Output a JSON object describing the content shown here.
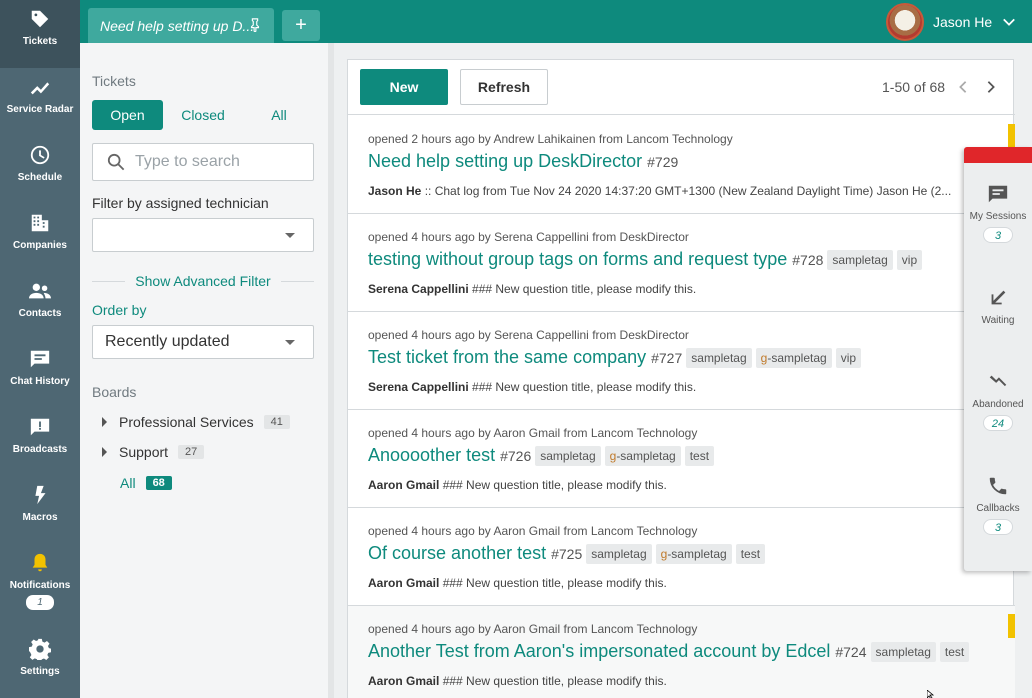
{
  "nav": {
    "items": [
      {
        "label": "Tickets",
        "icon": "tag-icon",
        "active": true
      },
      {
        "label": "Service Radar",
        "icon": "trend-icon"
      },
      {
        "label": "Schedule",
        "icon": "clock-icon"
      },
      {
        "label": "Companies",
        "icon": "building-icon"
      },
      {
        "label": "Contacts",
        "icon": "people-icon"
      },
      {
        "label": "Chat History",
        "icon": "chat-icon"
      },
      {
        "label": "Broadcasts",
        "icon": "alert-icon"
      },
      {
        "label": "Macros",
        "icon": "bolt-icon"
      },
      {
        "label": "Notifications",
        "icon": "bell-icon",
        "badge": "1"
      },
      {
        "label": "Settings",
        "icon": "gear-icon"
      }
    ]
  },
  "topbar": {
    "tab_title": "Need help setting up D...",
    "add_tab": "+",
    "user_name": "Jason He"
  },
  "filter": {
    "heading": "Tickets",
    "status_tabs": [
      "Open",
      "Closed",
      "All"
    ],
    "search_placeholder": "Type to search",
    "technician_label": "Filter by assigned technician",
    "technician_value": "",
    "advanced_filter": "Show Advanced Filter",
    "order_label": "Order by",
    "order_value": "Recently updated",
    "boards_heading": "Boards",
    "boards": [
      {
        "name": "Professional Services",
        "count": "41"
      },
      {
        "name": "Support",
        "count": "27"
      }
    ],
    "all_label": "All",
    "all_count": "68"
  },
  "toolbar": {
    "new_label": "New",
    "refresh_label": "Refresh",
    "pager": "1-50 of 68"
  },
  "tickets": [
    {
      "meta_opened": "opened 2 hours ago by",
      "author": "Andrew Lahikainen",
      "from": "from",
      "company": "Lancom Technology",
      "title": "Need help setting up DeskDirector",
      "number": "#729",
      "tags": [],
      "snippet_author": "Jason He",
      "snippet_text": " :: Chat log from Tue Nov 24 2020 14:37:20 GMT+1300 (New Zealand Daylight Time) Jason He (2...",
      "flag": true
    },
    {
      "meta_opened": "opened 4 hours ago by",
      "author": "Serena Cappellini",
      "from": "from",
      "company": "DeskDirector",
      "title": "testing without group tags on forms and request type",
      "number": "#728",
      "tags": [
        {
          "prefix": "",
          "text": "sampletag"
        },
        {
          "prefix": "",
          "text": "vip"
        }
      ],
      "snippet_author": "Serena Cappellini",
      "snippet_text": " ### New question title, please modify this.",
      "flag": false
    },
    {
      "meta_opened": "opened 4 hours ago by",
      "author": "Serena Cappellini",
      "from": "from",
      "company": "DeskDirector",
      "title": "Test ticket from the same company",
      "number": "#727",
      "tags": [
        {
          "prefix": "",
          "text": "sampletag"
        },
        {
          "prefix": "g",
          "text": "-sampletag"
        },
        {
          "prefix": "",
          "text": "vip"
        }
      ],
      "snippet_author": "Serena Cappellini",
      "snippet_text": " ### New question title, please modify this.",
      "flag": false
    },
    {
      "meta_opened": "opened 4 hours ago by",
      "author": "Aaron Gmail",
      "from": "from",
      "company": "Lancom Technology",
      "title": "Anoooother test",
      "number": "#726",
      "tags": [
        {
          "prefix": "",
          "text": "sampletag"
        },
        {
          "prefix": "g",
          "text": "-sampletag"
        },
        {
          "prefix": "",
          "text": "test"
        }
      ],
      "snippet_author": "Aaron Gmail",
      "snippet_text": " ### New question title, please modify this.",
      "flag": false
    },
    {
      "meta_opened": "opened 4 hours ago by",
      "author": "Aaron Gmail",
      "from": "from",
      "company": "Lancom Technology",
      "title": "Of course another test",
      "number": "#725",
      "tags": [
        {
          "prefix": "",
          "text": "sampletag"
        },
        {
          "prefix": "g",
          "text": "-sampletag"
        },
        {
          "prefix": "",
          "text": "test"
        }
      ],
      "snippet_author": "Aaron Gmail",
      "snippet_text": " ### New question title, please modify this.",
      "flag": false
    },
    {
      "meta_opened": "opened 4 hours ago by",
      "author": "Aaron Gmail",
      "from": "from",
      "company": "Lancom Technology",
      "title": "Another Test from Aaron's impersonated account by Edcel",
      "number": "#724",
      "tags": [
        {
          "prefix": "",
          "text": "sampletag"
        },
        {
          "prefix": "",
          "text": "test"
        }
      ],
      "snippet_author": "Aaron Gmail",
      "snippet_text": " ### New question title, please modify this.",
      "flag": true
    }
  ],
  "dock": {
    "items": [
      {
        "label": "My Sessions",
        "icon": "message-icon",
        "badge": "3"
      },
      {
        "label": "Waiting",
        "icon": "arrow-down-left-icon",
        "badge": ""
      },
      {
        "label": "Abandoned",
        "icon": "abandoned-icon",
        "badge": "24"
      },
      {
        "label": "Callbacks",
        "icon": "phone-icon",
        "badge": "3"
      }
    ]
  },
  "colors": {
    "brand": "#0e8a7d",
    "nav": "#4e6773",
    "alert": "#e0262a",
    "flag": "#f2c200"
  }
}
